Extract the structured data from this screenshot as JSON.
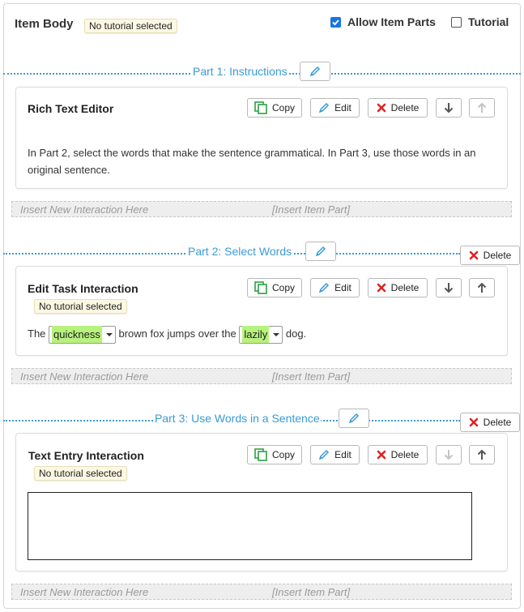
{
  "header": {
    "title": "Item Body",
    "tutorial_badge": "No tutorial selected",
    "allow_item_parts": {
      "label": "Allow Item Parts",
      "checked": true
    },
    "tutorial": {
      "label": "Tutorial",
      "checked": false
    }
  },
  "buttons": {
    "copy": "Copy",
    "edit": "Edit",
    "delete": "Delete"
  },
  "parts": [
    {
      "label": "Part 1: Instructions",
      "card": {
        "title": "Rich Text Editor",
        "text": "In Part 2, select the words that make the sentence grammatical. In Part 3, use those words in an original sentence."
      }
    },
    {
      "label": "Part 2: Select Words",
      "delete_label": "Delete",
      "card": {
        "title": "Edit Task Interaction",
        "tutorial_badge": "No tutorial selected",
        "sentence": {
          "before": "The",
          "select1": "quickness",
          "middle": "brown fox jumps over the",
          "select2": "lazily",
          "after": "dog."
        }
      }
    },
    {
      "label": "Part 3: Use Words in a Sentence",
      "delete_label": "Delete",
      "card": {
        "title": "Text Entry Interaction",
        "tutorial_badge": "No tutorial selected",
        "textarea_value": ""
      }
    }
  ],
  "insert_bar": {
    "interaction": "Insert New Interaction Here",
    "item_part": "[Insert Item Part]"
  },
  "colors": {
    "accent_blue": "#3a9bd6",
    "delete_red": "#e02424",
    "copy_green": "#2e9e44",
    "highlight_green": "#b7f27c",
    "badge_bg": "#fcf8e3"
  }
}
